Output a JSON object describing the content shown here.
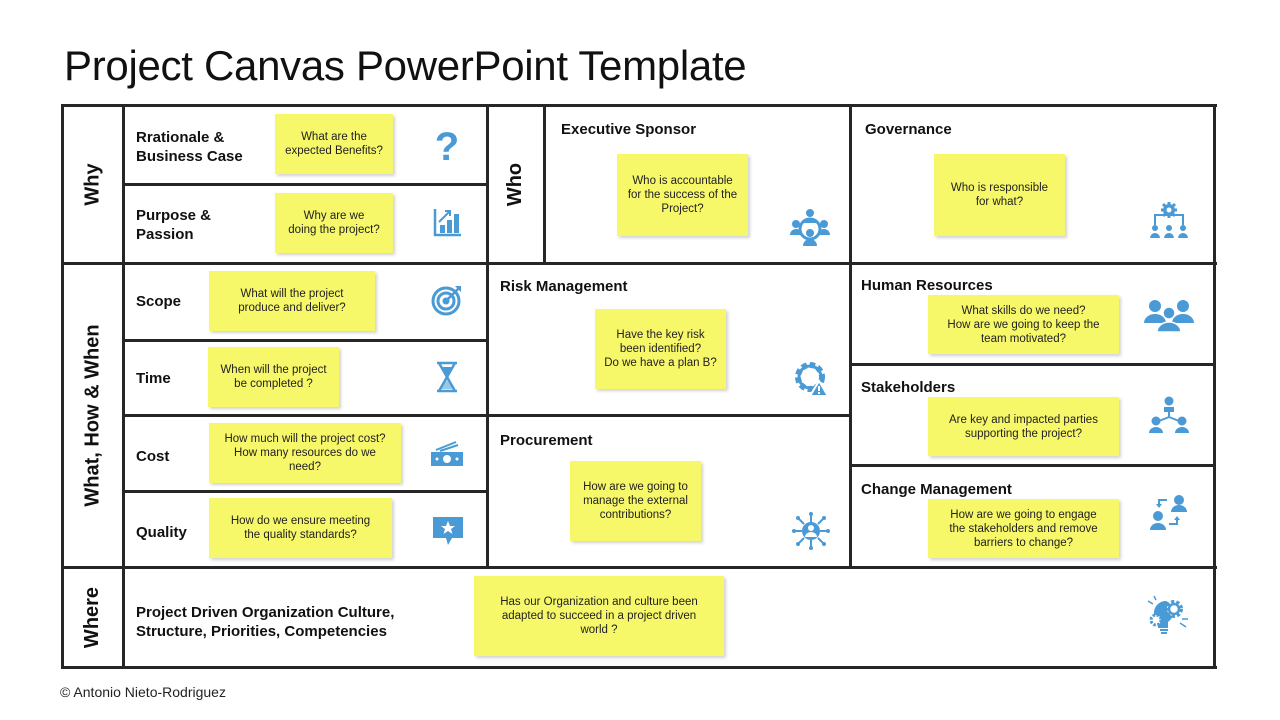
{
  "title": "Project Canvas PowerPoint Template",
  "footer": "© Antonio Nieto-Rodriguez",
  "accent_color": "#4a9ad6",
  "note_color": "#f7f76a",
  "sections": {
    "why": {
      "label": "Why",
      "items": [
        {
          "heading": "Rrationale &\nBusiness Case",
          "note": "What are the\nexpected Benefits?",
          "icon": "question-icon"
        },
        {
          "heading": "Purpose &\nPassion",
          "note": "Why are we\ndoing the project?",
          "icon": "growth-chart-icon"
        }
      ]
    },
    "who": {
      "label": "Who",
      "items": [
        {
          "heading": "Executive Sponsor",
          "note": "Who is accountable\nfor the success of the\nProject?",
          "icon": "team-meeting-icon"
        },
        {
          "heading": "Governance",
          "note": "Who is responsible\nfor what?",
          "icon": "org-gear-icon"
        }
      ]
    },
    "what": {
      "label": "What,  How & When",
      "items": [
        {
          "heading": "Scope",
          "note": "What will the project\nproduce and deliver?",
          "icon": "target-icon"
        },
        {
          "heading": "Time",
          "note": "When will the project\nbe completed ?",
          "icon": "hourglass-icon"
        },
        {
          "heading": "Cost",
          "note": "How much will the project cost?\nHow many resources do we\nneed?",
          "icon": "money-icon"
        },
        {
          "heading": "Quality",
          "note": "How do we ensure meeting\nthe quality standards?",
          "icon": "star-badge-icon"
        }
      ]
    },
    "middle": {
      "items": [
        {
          "heading": "Risk Management",
          "note": "Have the key risk\nbeen identified?\nDo we have a plan B?",
          "icon": "gear-warning-icon"
        },
        {
          "heading": "Procurement",
          "note": "How are we going to\nmanage the external\ncontributions?",
          "icon": "network-person-icon"
        }
      ]
    },
    "right": {
      "items": [
        {
          "heading": "Human Resources",
          "note": "What skills do we need?\nHow are we going to keep the\nteam motivated?",
          "icon": "group-icon"
        },
        {
          "heading": "Stakeholders",
          "note": "Are key and impacted parties\nsupporting the project?",
          "icon": "hierarchy-people-icon"
        },
        {
          "heading": "Change Management",
          "note": "How are we going to engage\nthe stakeholders and remove\nbarriers to change?",
          "icon": "people-exchange-icon"
        }
      ]
    },
    "where": {
      "label": "Where",
      "heading": "Project Driven Organization Culture,\nStructure, Priorities, Competencies",
      "note": "Has our Organization and culture been\nadapted to succeed in a project driven\nworld ?",
      "icon": "lightbulb-gears-icon"
    }
  }
}
